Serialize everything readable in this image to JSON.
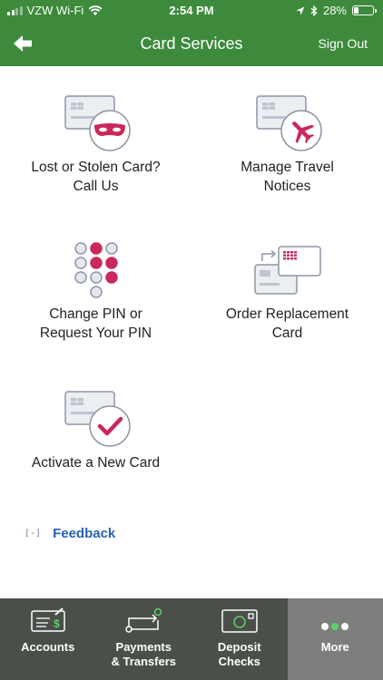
{
  "status": {
    "carrier": "VZW Wi-Fi",
    "time": "2:54 PM",
    "battery": "28%"
  },
  "nav": {
    "title": "Card Services",
    "sign_out": "Sign Out",
    "back_icon": "back-arrow-icon"
  },
  "services": [
    {
      "line1": "Lost or Stolen Card?",
      "line2": "Call Us",
      "icon": "card-thief-icon"
    },
    {
      "line1": "Manage Travel",
      "line2": "Notices",
      "icon": "card-plane-icon"
    },
    {
      "line1": "Change PIN or",
      "line2": "Request Your PIN",
      "icon": "pin-keypad-icon"
    },
    {
      "line1": "Order Replacement",
      "line2": "Card",
      "icon": "replacement-card-icon"
    },
    {
      "line1": "Activate a New Card",
      "line2": "",
      "icon": "card-check-icon"
    }
  ],
  "feedback": {
    "icon_text": "[-]",
    "label": "Feedback"
  },
  "tabs": [
    {
      "label_line1": "Accounts",
      "label_line2": "",
      "icon": "accounts-icon"
    },
    {
      "label_line1": "Payments",
      "label_line2": "& Transfers",
      "icon": "transfer-icon"
    },
    {
      "label_line1": "Deposit",
      "label_line2": "Checks",
      "icon": "check-icon"
    },
    {
      "label_line1": "More",
      "label_line2": "",
      "icon": "more-dots-icon"
    }
  ],
  "colors": {
    "brand_green": "#3d8a3c",
    "accent_magenta": "#c8295a",
    "tabbar": "#4a4f4a",
    "tab_active": "#7c7f7c",
    "link_blue": "#2a62b0"
  }
}
